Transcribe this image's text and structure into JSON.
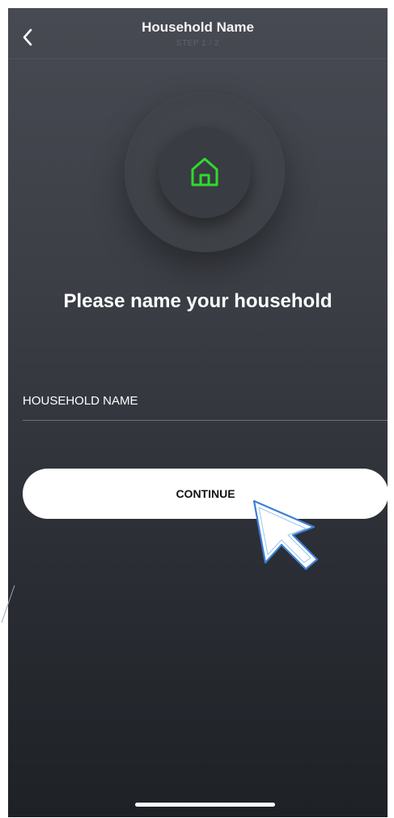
{
  "header": {
    "title": "Household Name",
    "step": "STEP 1 / 2"
  },
  "hero": {
    "icon": "house-icon",
    "icon_color": "#2ddc2d"
  },
  "prompt": "Please name your household",
  "field": {
    "label": "HOUSEHOLD NAME",
    "value": ""
  },
  "continue_label": "CONTINUE",
  "colors": {
    "accent": "#2ddc2d",
    "background_top": "#474a52",
    "background_bottom": "#1e2126",
    "button_bg": "#ffffff",
    "button_text": "#111111"
  }
}
